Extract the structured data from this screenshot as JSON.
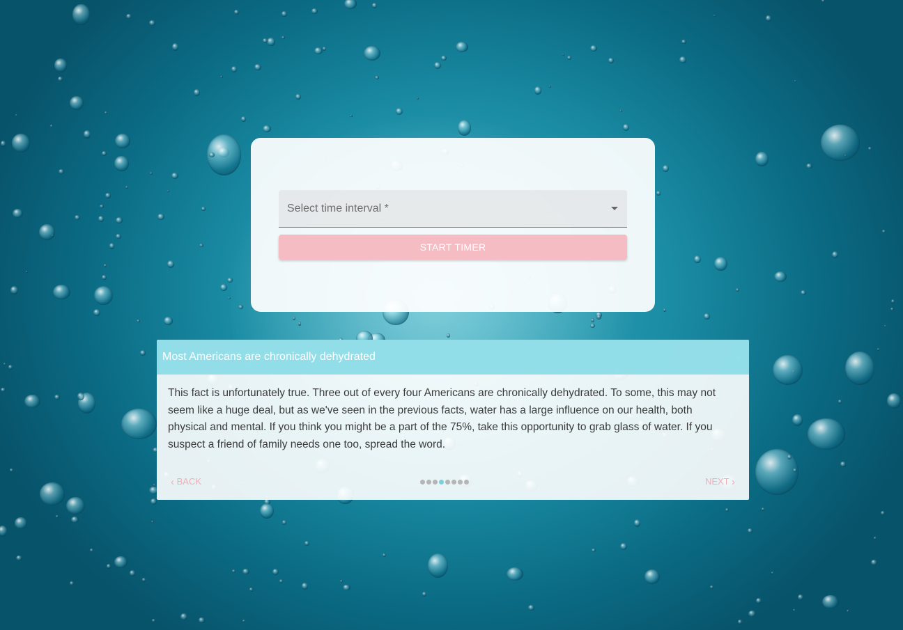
{
  "timer": {
    "select_placeholder": "Select time interval *",
    "start_button_label": "START TIMER"
  },
  "fact": {
    "title": "Most Americans are chronically dehydrated",
    "body": "This fact is unfortunately true. Three out of every four Americans are chronically dehydrated. To some, this may not seem like a huge deal, but as we've seen in the previous facts, water has a large influence on our health, both physical and mental. If you think you might be a part of the 75%, take this opportunity to grab glass of water. If you suspect a friend of family needs one too, spread the word.",
    "back_label": "BACK",
    "next_label": "NEXT",
    "total_steps": 8,
    "active_step": 4
  },
  "colors": {
    "accent_pink": "#f5bcc4",
    "header_teal": "#8adbe6",
    "active_dot": "#7ccfdc"
  },
  "icons": {
    "select": "chevron-down-icon",
    "back": "chevron-left-icon",
    "next": "chevron-right-icon"
  }
}
